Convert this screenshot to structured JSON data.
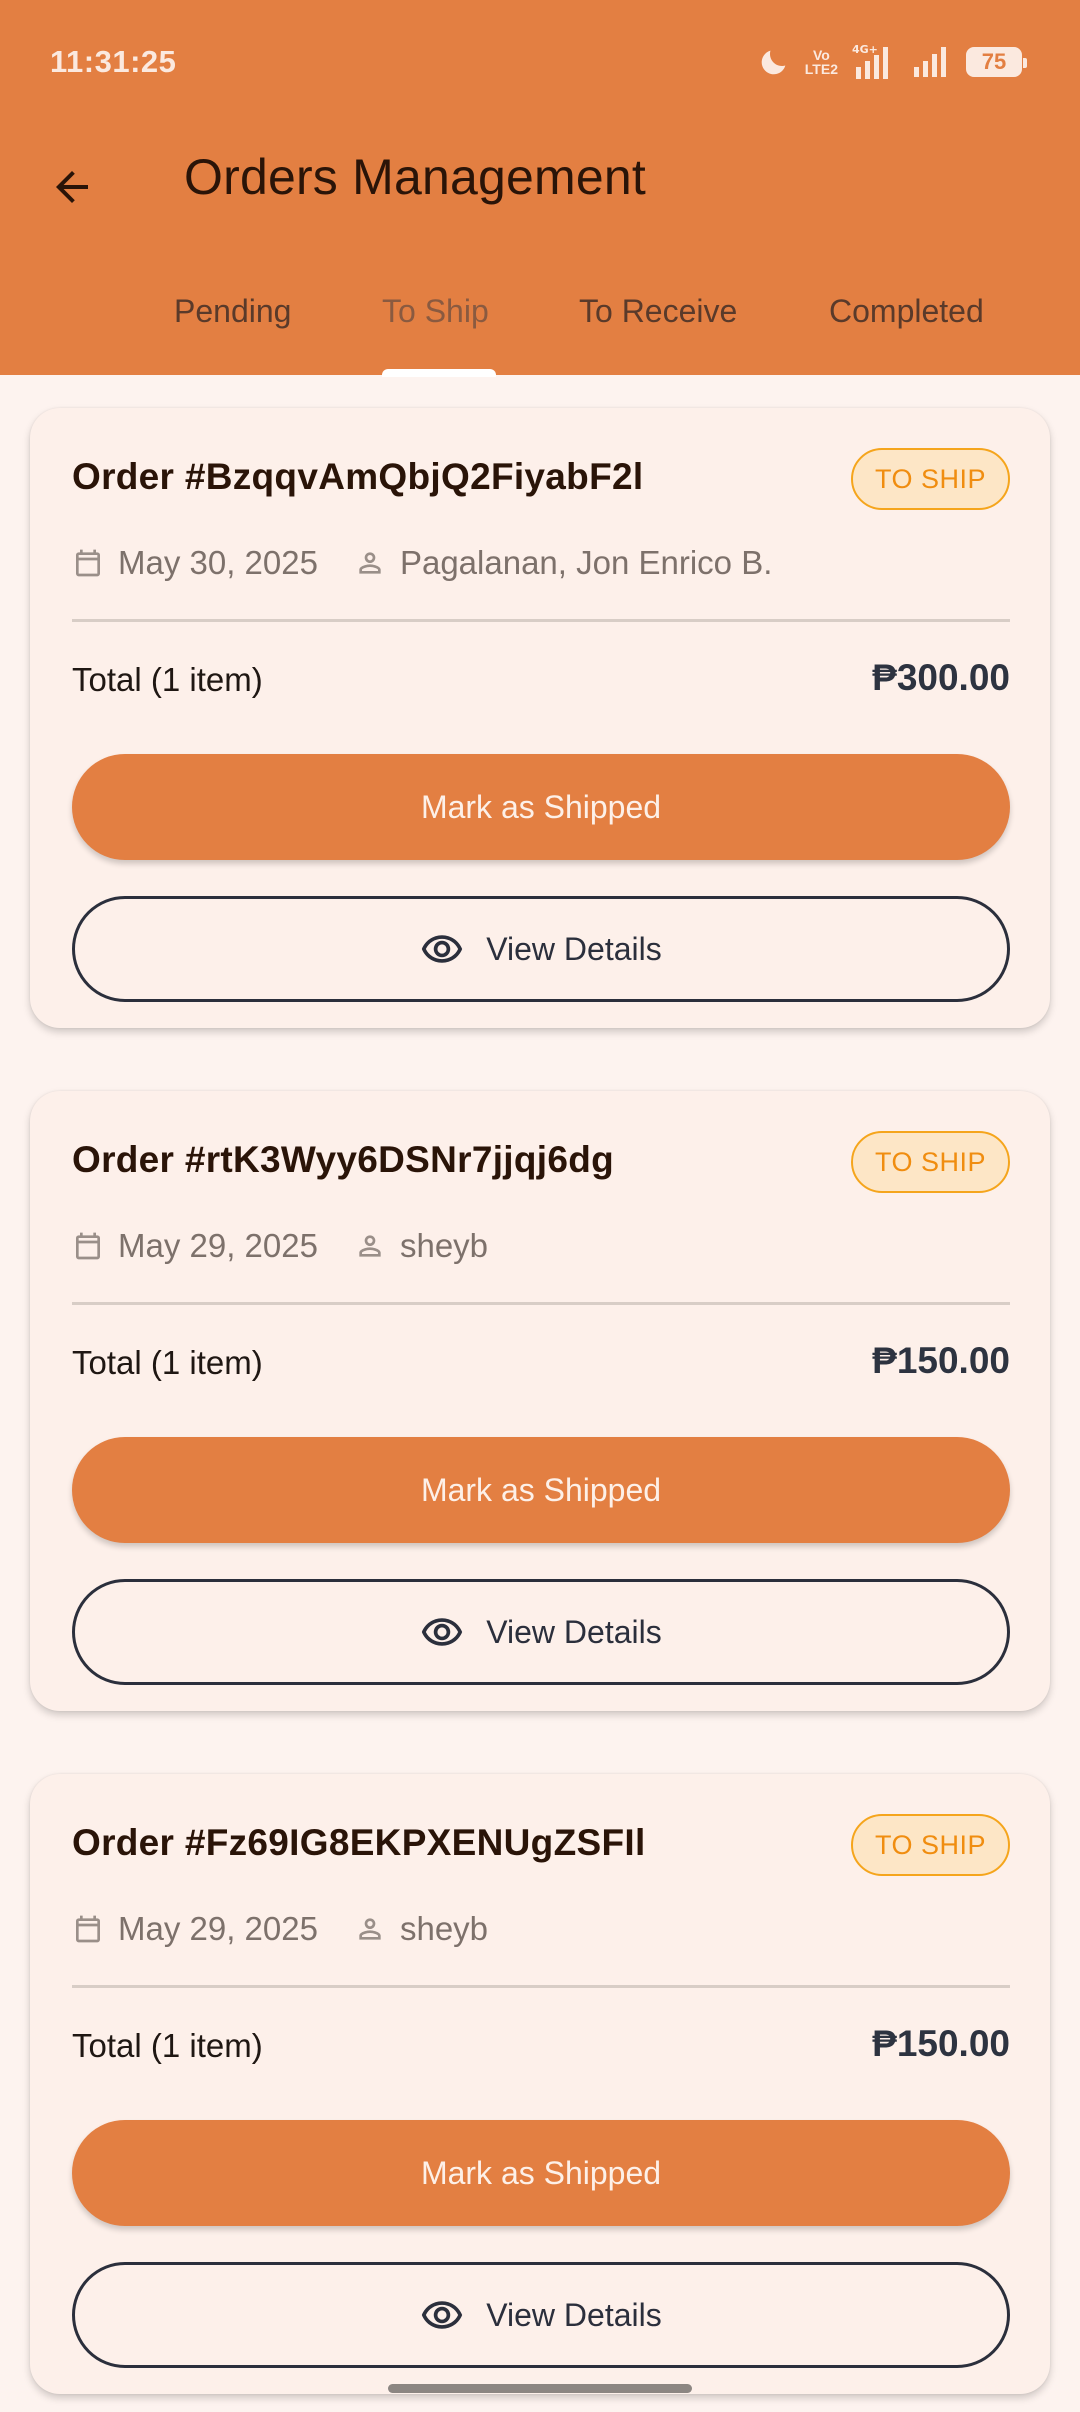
{
  "status_bar": {
    "time": "11:31:25",
    "network": "4G+",
    "volte": [
      "Vo",
      "LTE2"
    ],
    "battery": "75"
  },
  "header": {
    "title": "Orders Management",
    "back_icon": "arrow-left-icon"
  },
  "tabs": [
    {
      "label": "Pending",
      "active": false
    },
    {
      "label": "To Ship",
      "active": true
    },
    {
      "label": "To Receive",
      "active": false
    },
    {
      "label": "Completed",
      "active": false
    }
  ],
  "orders": [
    {
      "id": "Order #BzqqvAmQbjQ2FiyabF2l",
      "status": "TO SHIP",
      "date": "May 30, 2025",
      "customer": "Pagalanan, Jon Enrico B.",
      "total_label": "Total (1 item)",
      "total": "₱300.00",
      "primary_action": "Mark as Shipped",
      "secondary_action": "View Details"
    },
    {
      "id": "Order #rtK3Wyy6DSNr7jjqj6dg",
      "status": "TO SHIP",
      "date": "May 29, 2025",
      "customer": "sheyb",
      "total_label": "Total (1 item)",
      "total": "₱150.00",
      "primary_action": "Mark as Shipped",
      "secondary_action": "View Details"
    },
    {
      "id": "Order #Fz69IG8EKPXENUgZSFIl",
      "status": "TO SHIP",
      "date": "May 29, 2025",
      "customer": "sheyb",
      "total_label": "Total (1 item)",
      "total": "₱150.00",
      "primary_action": "Mark as Shipped",
      "secondary_action": "View Details"
    }
  ],
  "colors": {
    "primary": "#e37f42",
    "background": "#fdf3ef",
    "badge_border": "#f5a51c",
    "badge_fill": "#fde6c6",
    "badge_text": "#f08d10"
  }
}
